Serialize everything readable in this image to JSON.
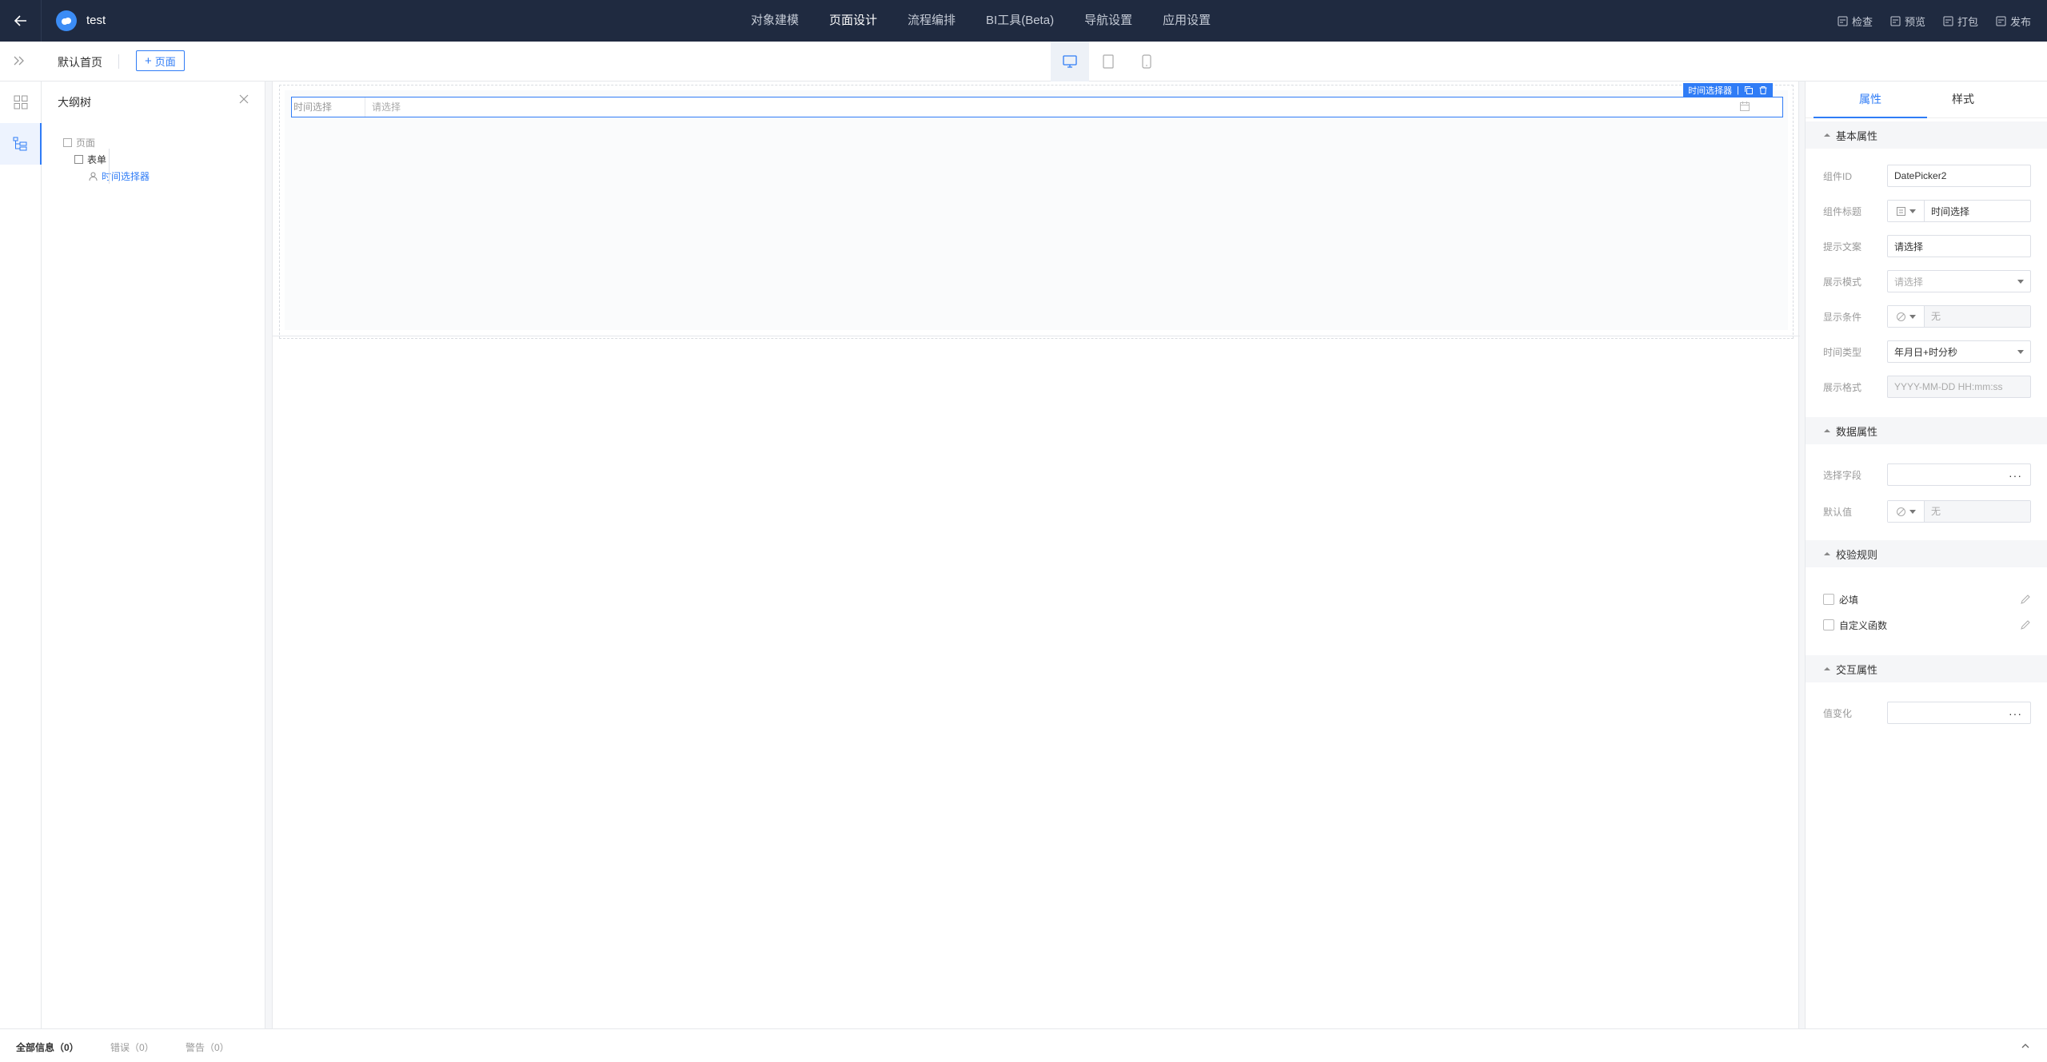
{
  "header": {
    "app_name": "test",
    "nav": [
      "对象建模",
      "页面设计",
      "流程编排",
      "BI工具(Beta)",
      "导航设置",
      "应用设置"
    ],
    "active_nav_index": 1,
    "actions": [
      "检查",
      "预览",
      "打包",
      "发布"
    ]
  },
  "toolbar": {
    "page_name": "默认首页",
    "add_page_label": "页面",
    "devices": [
      "desktop-icon",
      "tablet-icon",
      "mobile-icon"
    ],
    "active_device": "desktop-icon"
  },
  "outline": {
    "title": "大纲树",
    "tree": [
      {
        "label": "页面",
        "icon": "page-icon",
        "level": 0
      },
      {
        "label": "表单",
        "icon": "form-icon",
        "level": 1
      },
      {
        "label": "时间选择器",
        "icon": "component-icon",
        "level": 2,
        "selected": true
      }
    ]
  },
  "canvas": {
    "field_label": "时间选择",
    "field_placeholder": "请选择",
    "selected_badge": "时间选择器",
    "selected_badge_sep": "|"
  },
  "props": {
    "tabs": [
      "属性",
      "样式"
    ],
    "active_tab": 0,
    "sections": {
      "basic": "基本属性",
      "data": "数据属性",
      "validation": "校验规则",
      "interaction": "交互属性"
    },
    "basic": {
      "component_id": {
        "label": "组件ID",
        "value": "DatePicker2"
      },
      "component_title": {
        "label": "组件标题",
        "value": "时间选择"
      },
      "hint_text": {
        "label": "提示文案",
        "value": "请选择"
      },
      "display_mode": {
        "label": "展示模式",
        "value": "请选择"
      },
      "display_condition": {
        "label": "显示条件",
        "value": "无"
      },
      "time_type": {
        "label": "时间类型",
        "value": "年月日+时分秒"
      },
      "display_format": {
        "label": "展示格式",
        "value": "YYYY-MM-DD HH:mm:ss"
      }
    },
    "data": {
      "select_field": {
        "label": "选择字段",
        "value": ""
      },
      "default_value": {
        "label": "默认值",
        "value": "无"
      }
    },
    "validation": {
      "required": "必填",
      "custom_func": "自定义函数"
    },
    "interaction": {
      "on_change": {
        "label": "值变化",
        "value": ""
      }
    },
    "dots": "···"
  },
  "status": {
    "all": "全部信息（0）",
    "errors": "错误（0）",
    "warnings": "警告（0）"
  },
  "colors": {
    "accent": "#2f7cf6",
    "topbar": "#1f2a40"
  }
}
